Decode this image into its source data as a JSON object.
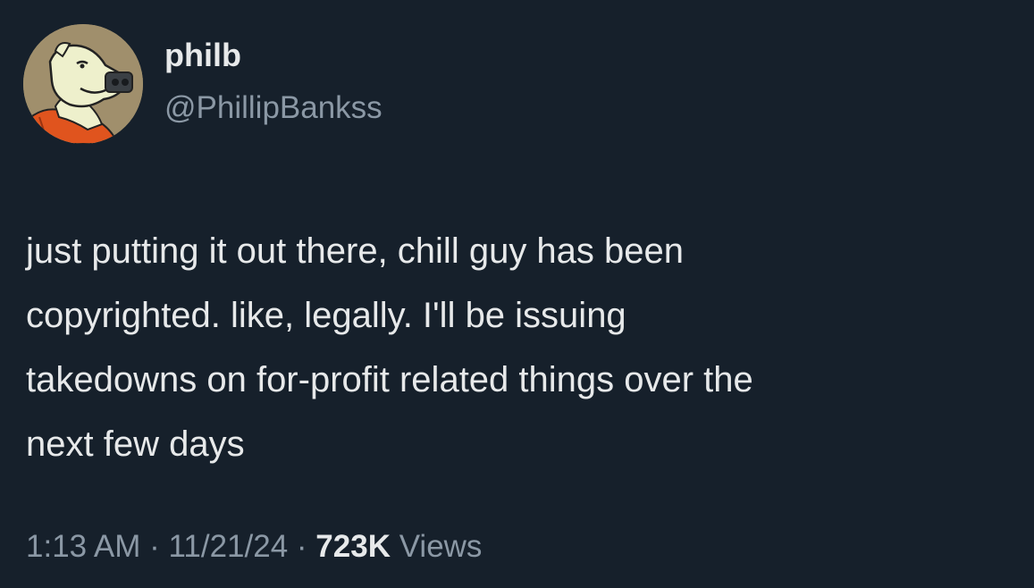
{
  "author": {
    "display_name": "philb",
    "handle": "@PhillipBankss"
  },
  "tweet": {
    "lines": [
      "just putting it out there, chill guy has been",
      "copyrighted. like, legally. I'll be issuing",
      "takedowns on for-profit related things over the",
      "next few days"
    ]
  },
  "meta": {
    "time": "1:13 AM",
    "separator": " · ",
    "date": "11/21/24",
    "views_count": "723K",
    "views_label": "Views"
  },
  "colors": {
    "background": "#16202b",
    "primary_text": "#e7e9ea",
    "secondary_text": "#8b98a5"
  }
}
